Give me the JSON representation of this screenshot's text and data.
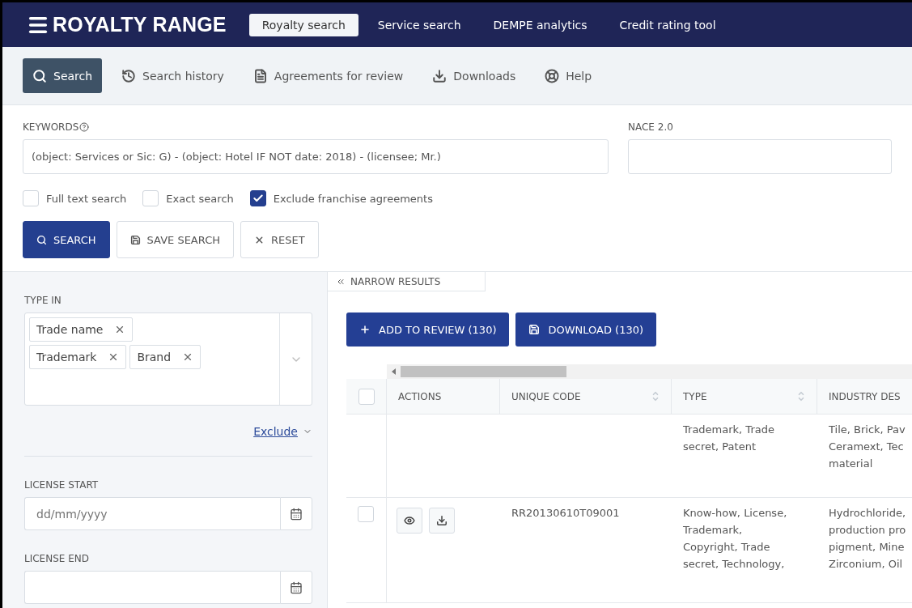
{
  "header": {
    "logo": "ROYALTY RANGE",
    "tabs": [
      {
        "label": "Royalty search",
        "selected": true
      },
      {
        "label": "Service search",
        "selected": false
      },
      {
        "label": "DEMPE analytics",
        "selected": false
      },
      {
        "label": "Credit rating tool",
        "selected": false
      }
    ]
  },
  "toolbar": [
    {
      "label": "Search",
      "selected": true
    },
    {
      "label": "Search history",
      "selected": false
    },
    {
      "label": "Agreements for review",
      "selected": false
    },
    {
      "label": "Downloads",
      "selected": false
    },
    {
      "label": "Help",
      "selected": false
    }
  ],
  "search_form": {
    "keywords_label": "KEYWORDS",
    "keywords_value": "(object: Services or Sic: G) - (object: Hotel IF NOT date: 2018) - (licensee; Mr.)",
    "nace_label": "NACE 2.0",
    "options": [
      {
        "label": "Full text search",
        "checked": false
      },
      {
        "label": "Exact search",
        "checked": false
      },
      {
        "label": "Exclude franchise agreements",
        "checked": true
      }
    ],
    "buttons": [
      {
        "label": "SEARCH",
        "kind": "primary"
      },
      {
        "label": "SAVE SEARCH",
        "kind": "secondary"
      },
      {
        "label": "RESET",
        "kind": "secondary"
      }
    ]
  },
  "filters": {
    "type_in": {
      "label": "TYPE IN",
      "tags": [
        "Trade name",
        "Trademark",
        "Brand"
      ]
    },
    "exclude_link": "Exclude",
    "license_start": {
      "label": "LICENSE START",
      "placeholder": "dd/mm/yyyy"
    },
    "license_end": {
      "label": "LICENSE END"
    }
  },
  "results": {
    "narrow_tab": "NARROW RESULTS",
    "actions": [
      {
        "label": "ADD TO REVIEW (130)"
      },
      {
        "label": "DOWNLOAD (130)"
      }
    ],
    "select_all_checked": false,
    "columns": [
      {
        "label": "ACTIONS",
        "sortable": false
      },
      {
        "label": "UNIQUE CODE",
        "sortable": true
      },
      {
        "label": "TYPE",
        "sortable": true
      },
      {
        "label": "INDUSTRY DES",
        "sortable": false
      }
    ],
    "rows": [
      {
        "type": "Trademark, Trade\nsecret, Patent",
        "industry": "Tile, Brick, Pav\nCeramext, Tec\nmaterial"
      },
      {
        "checked": false,
        "code": "RR20130610T09001",
        "type": "Know-how, License,\nTrademark,\nCopyright, Trade\nsecret, Technology,",
        "industry": "Hydrochloride,\nproduction pro\npigment, Mine\nZirconium, Oil"
      }
    ]
  }
}
